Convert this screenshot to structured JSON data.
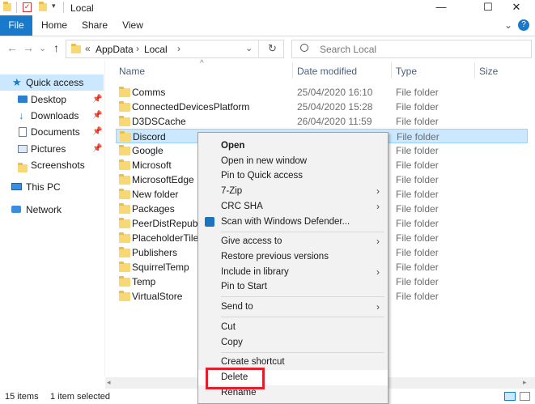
{
  "window": {
    "title": "Local",
    "minimize": "—",
    "maximize": "☐",
    "close": "✕"
  },
  "ribbon": {
    "tabs": [
      "File",
      "Home",
      "Share",
      "View"
    ],
    "expand": "⌄",
    "help": "?"
  },
  "nav": {
    "back": "←",
    "forward": "→",
    "dropdown": "⌄",
    "up": "↑",
    "breadcrumb_prefix": "«",
    "path": [
      "AppData",
      "Local"
    ],
    "path_sep": "›",
    "refresh": "↻",
    "search_placeholder": "Search Local"
  },
  "sidebar": {
    "items": [
      {
        "label": "Quick access",
        "icon": "star-icon",
        "pinned": false
      },
      {
        "label": "Desktop",
        "icon": "desktop-icon",
        "pinned": true
      },
      {
        "label": "Downloads",
        "icon": "download-icon",
        "pinned": true
      },
      {
        "label": "Documents",
        "icon": "documents-icon",
        "pinned": true
      },
      {
        "label": "Pictures",
        "icon": "pictures-icon",
        "pinned": true
      },
      {
        "label": "Screenshots",
        "icon": "folder-icon",
        "pinned": false
      },
      {
        "label": "This PC",
        "icon": "computer-icon",
        "pinned": false
      },
      {
        "label": "Network",
        "icon": "network-icon",
        "pinned": false
      }
    ]
  },
  "columns": {
    "name": "Name",
    "date": "Date modified",
    "type": "Type",
    "size": "Size"
  },
  "rows": [
    {
      "name": "Comms",
      "date": "25/04/2020 16:10",
      "type": "File folder"
    },
    {
      "name": "ConnectedDevicesPlatform",
      "date": "25/04/2020 15:28",
      "type": "File folder"
    },
    {
      "name": "D3DSCache",
      "date": "26/04/2020 11:59",
      "type": "File folder"
    },
    {
      "name": "Discord",
      "date": "",
      "type": "File folder"
    },
    {
      "name": "Google",
      "date": "",
      "type": "File folder"
    },
    {
      "name": "Microsoft",
      "date": "",
      "type": "File folder"
    },
    {
      "name": "MicrosoftEdge",
      "date": "",
      "type": "File folder"
    },
    {
      "name": "New folder",
      "date": "",
      "type": "File folder"
    },
    {
      "name": "Packages",
      "date": "",
      "type": "File folder"
    },
    {
      "name": "PeerDistRepub",
      "date": "",
      "type": "File folder"
    },
    {
      "name": "PlaceholderTileLo",
      "date": "",
      "type": "File folder"
    },
    {
      "name": "Publishers",
      "date": "",
      "type": "File folder"
    },
    {
      "name": "SquirrelTemp",
      "date": "",
      "type": "File folder"
    },
    {
      "name": "Temp",
      "date": "",
      "type": "File folder"
    },
    {
      "name": "VirtualStore",
      "date": "",
      "type": "File folder"
    }
  ],
  "context_menu": {
    "items": [
      {
        "label": "Open",
        "bold": true,
        "submenu": false
      },
      {
        "label": "Open in new window",
        "bold": false,
        "submenu": false
      },
      {
        "label": "Pin to Quick access",
        "bold": false,
        "submenu": false
      },
      {
        "label": "7-Zip",
        "bold": false,
        "submenu": true
      },
      {
        "label": "CRC SHA",
        "bold": false,
        "submenu": true
      },
      {
        "label": "Scan with Windows Defender...",
        "bold": false,
        "submenu": false,
        "icon": "defender-icon"
      },
      {
        "label": "Give access to",
        "bold": false,
        "submenu": true
      },
      {
        "label": "Restore previous versions",
        "bold": false,
        "submenu": false
      },
      {
        "label": "Include in library",
        "bold": false,
        "submenu": true
      },
      {
        "label": "Pin to Start",
        "bold": false,
        "submenu": false
      },
      {
        "label": "Send to",
        "bold": false,
        "submenu": true
      },
      {
        "label": "Cut",
        "bold": false,
        "submenu": false
      },
      {
        "label": "Copy",
        "bold": false,
        "submenu": false
      },
      {
        "label": "Create shortcut",
        "bold": false,
        "submenu": false
      },
      {
        "label": "Delete",
        "bold": false,
        "submenu": false,
        "highlighted": true
      },
      {
        "label": "Rename",
        "bold": false,
        "submenu": false
      }
    ],
    "submenu_arrow": "›"
  },
  "status": {
    "item_count": "15 items",
    "selection": "1 item selected"
  },
  "colors": {
    "accent": "#1979ca",
    "selection": "#cce8ff",
    "highlight_box": "#e0202c",
    "folder": "#f8d775"
  }
}
